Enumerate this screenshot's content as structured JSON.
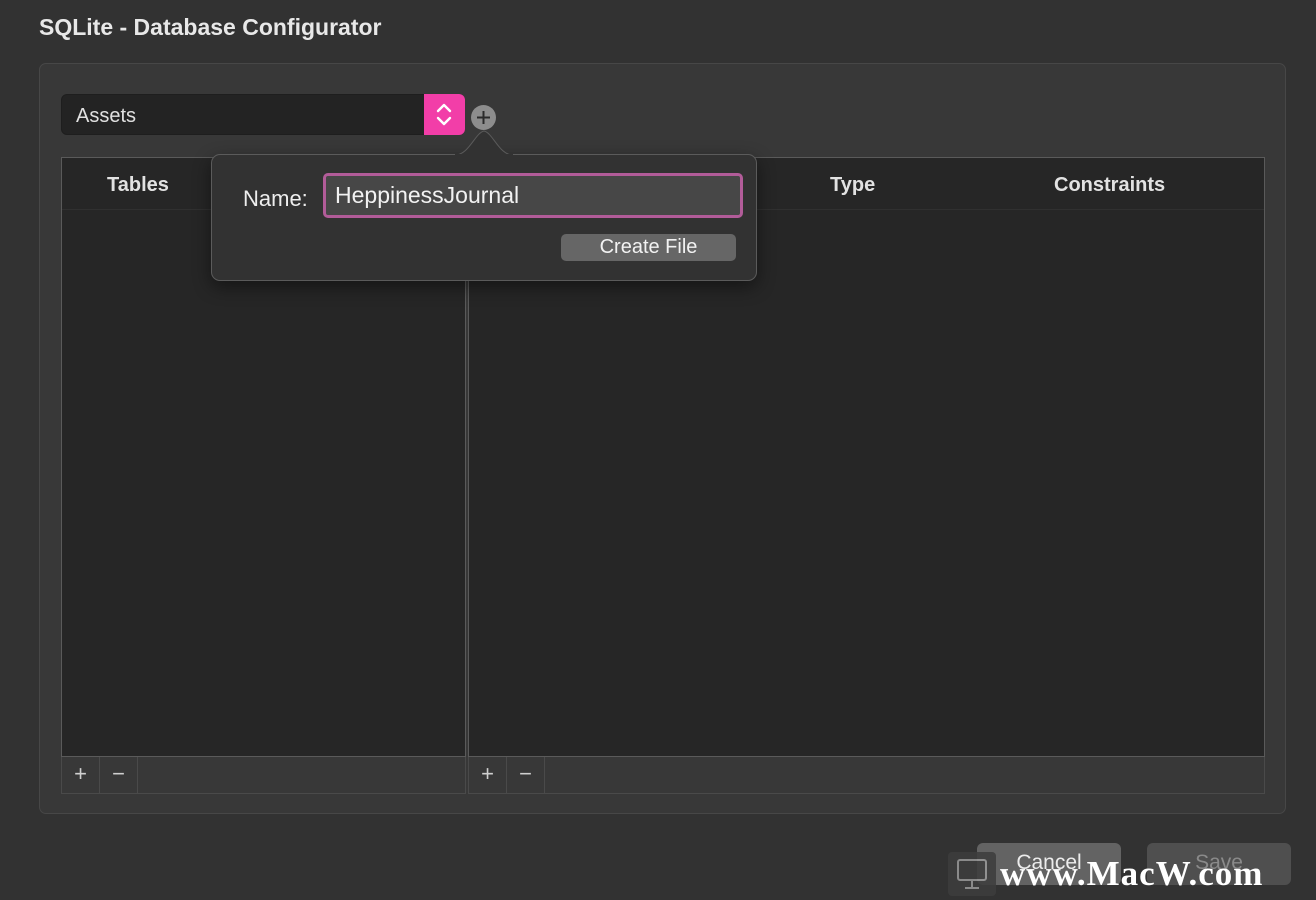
{
  "window": {
    "title": "SQLite - Database Configurator"
  },
  "database_select": {
    "value": "Assets"
  },
  "tables_pane": {
    "header": "Tables",
    "footer_buttons": [
      "+",
      "−"
    ]
  },
  "columns_pane": {
    "headers": [
      "Type",
      "Constraints"
    ],
    "footer_buttons": [
      "+",
      "−"
    ]
  },
  "popover": {
    "name_label": "Name:",
    "name_value": "HeppinessJournal",
    "create_label": "Create File"
  },
  "actions": {
    "cancel_label": "Cancel",
    "save_label": "Save"
  },
  "watermark": {
    "text": "www.MacW.com"
  },
  "colors": {
    "accent": "#f23ea8",
    "input_focus": "#b25c99",
    "background": "#323232"
  },
  "icons": {
    "select_stepper": "chevron-up-down-icon",
    "add": "plus-circle-icon"
  }
}
